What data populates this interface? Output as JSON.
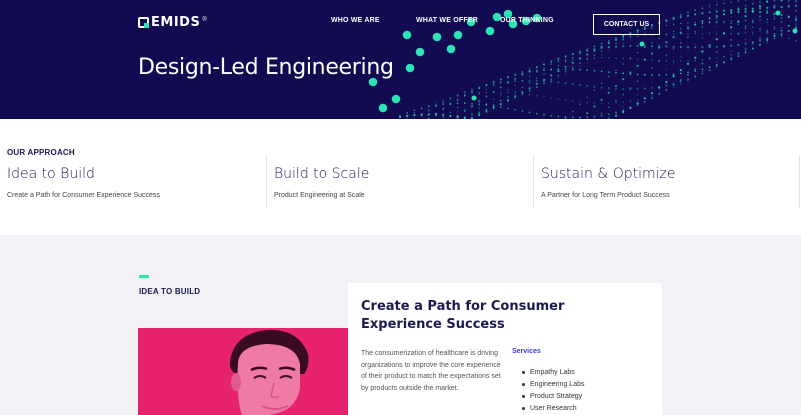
{
  "brand": {
    "name": "EMIDS",
    "reg": "®"
  },
  "nav": {
    "items": [
      "WHO WE ARE",
      "WHAT WE OFFER",
      "OUR THINKING"
    ],
    "contact_label": "CONTACT US"
  },
  "hero": {
    "title": "Design-Led Engineering"
  },
  "approach": {
    "label": "OUR APPROACH",
    "columns": [
      {
        "title": "Idea to Build",
        "subtitle": "Create a Path for Consumer Experience Success"
      },
      {
        "title": "Build to Scale",
        "subtitle": "Product Engineering at Scale"
      },
      {
        "title": "Sustain & Optimize",
        "subtitle": "A Partner for Long Term Product Success"
      }
    ]
  },
  "section": {
    "label": "IDEA TO BUILD",
    "card": {
      "title": "Create a Path for Consumer Experience Success",
      "body": "The consumerization of healthcare is driving organizations to improve the core experience of their product to match the expectations set by products outside the market.",
      "services_label": "Services",
      "services": [
        "Empathy Labs",
        "Engineering Labs",
        "Product Strategy",
        "User Research"
      ]
    }
  },
  "colors": {
    "navy": "#120b52",
    "accent": "#2ce3b6",
    "magenta": "#e7226e",
    "link": "#3f3ad8"
  }
}
